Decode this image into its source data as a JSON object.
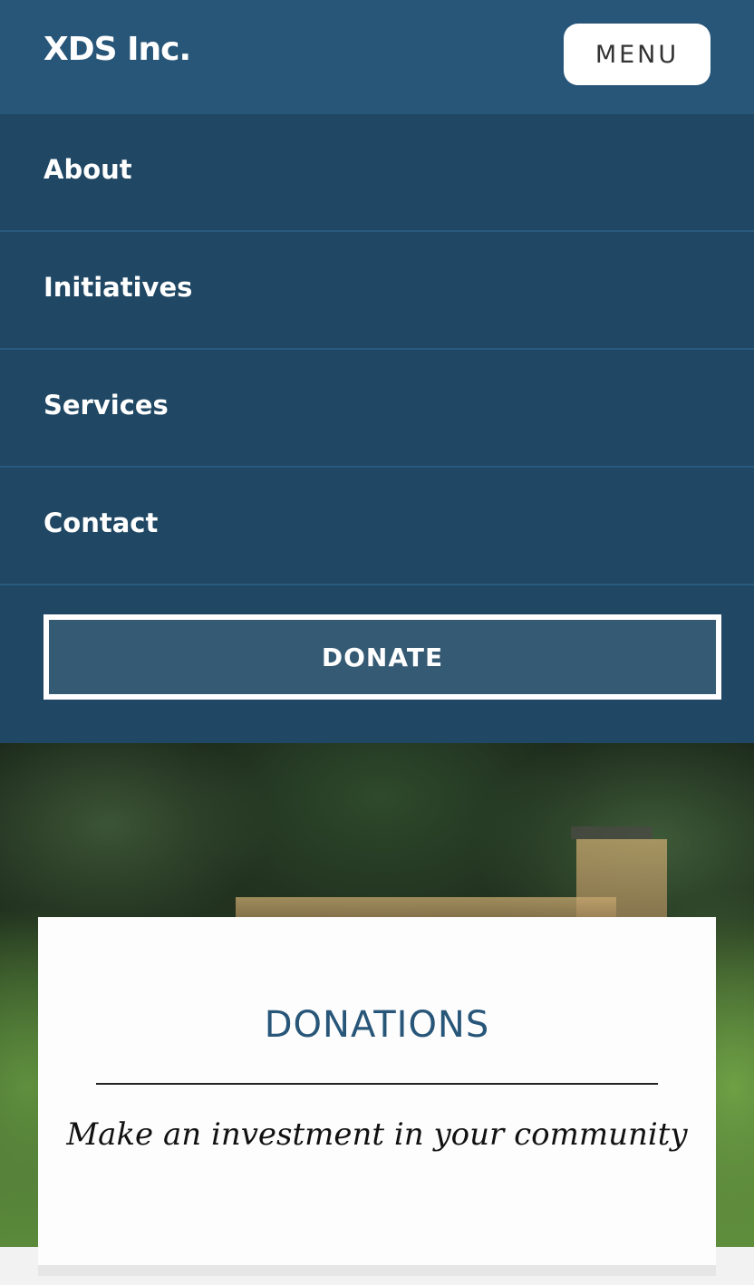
{
  "header": {
    "brand": "XDS Inc.",
    "menu_label": "MENU"
  },
  "nav": {
    "items": [
      {
        "label": "About"
      },
      {
        "label": "Initiatives"
      },
      {
        "label": "Services"
      },
      {
        "label": "Contact"
      }
    ],
    "donate_label": "DONATE"
  },
  "hero": {
    "title": "DONATIONS",
    "subtitle": "Make an investment in your community"
  },
  "colors": {
    "header_bg": "#285679",
    "nav_bg": "#204763",
    "accent": "#285679"
  }
}
